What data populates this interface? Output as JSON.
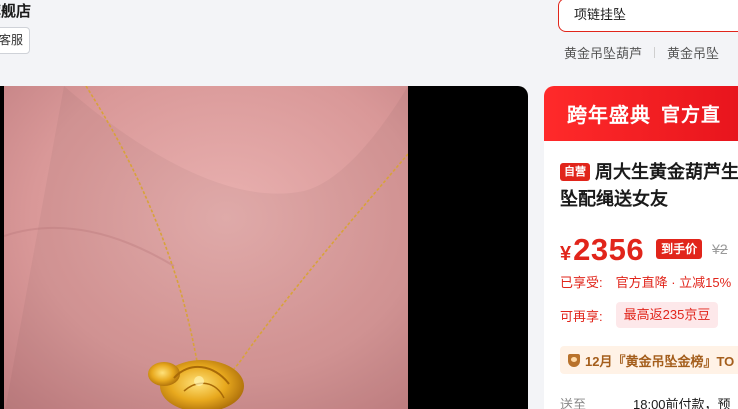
{
  "shop": {
    "name": "旗舰店",
    "follow_label": "客服"
  },
  "search": {
    "value": "项链挂坠",
    "hot_words": [
      "黄金吊坠葫芦",
      "黄金吊坠"
    ]
  },
  "product": {
    "banner_left": "跨年盛典",
    "banner_right": "官方直",
    "self_tag": "自营",
    "title": "周大生黄金葫芦生财挂坠配绳送女友",
    "currency": "¥",
    "price": "2356",
    "price_tag": "到手价",
    "original_price": "¥2",
    "promo_label": "已享受:",
    "promo_value": "官方直降 · 立减15%",
    "extra_label": "可再享:",
    "beans_value": "最高返235京豆",
    "rank_text": "12月『黄金吊坠金榜』TO",
    "ship_label": "送至",
    "ship_value": "18:00前付款，预"
  },
  "colors": {
    "accent": "#e1251b",
    "rank_bg": "#fff2e6",
    "rank_text": "#a45e1c"
  }
}
